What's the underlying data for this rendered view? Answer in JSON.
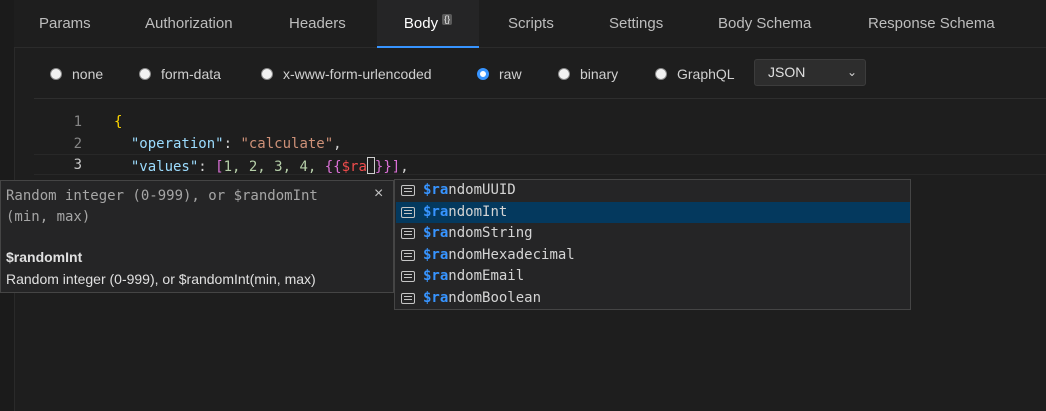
{
  "tabs": [
    {
      "label": "Params"
    },
    {
      "label": "Authorization"
    },
    {
      "label": "Headers"
    },
    {
      "label": "Body",
      "badge": "{}"
    },
    {
      "label": "Scripts"
    },
    {
      "label": "Settings"
    },
    {
      "label": "Body Schema"
    },
    {
      "label": "Response Schema"
    }
  ],
  "active_tab": "Body",
  "body_types": [
    {
      "label": "none",
      "checked": false
    },
    {
      "label": "form-data",
      "checked": false
    },
    {
      "label": "x-www-form-urlencoded",
      "checked": false
    },
    {
      "label": "raw",
      "checked": true
    },
    {
      "label": "binary",
      "checked": false
    },
    {
      "label": "GraphQL",
      "checked": false
    }
  ],
  "format_select": {
    "value": "JSON"
  },
  "editor": {
    "line_numbers": [
      "1",
      "2",
      "3"
    ],
    "line1": {
      "brace": "{"
    },
    "line2": {
      "key": "\"operation\"",
      "colon": ": ",
      "value": "\"calculate\"",
      "comma": ","
    },
    "line3": {
      "key": "\"values\"",
      "colon": ": ",
      "open_bracket": "[",
      "nums": "1, 2, 3, 4, ",
      "var_open": "{{",
      "var_typed": "$ra",
      "var_close": "}}",
      "close_bracket": "]",
      "comma": ","
    }
  },
  "suggest_detail": {
    "signature": "Random integer (0-999), or $randomInt (min, max)",
    "name": "$randomInt",
    "description": "Random integer (0-999), or $randomInt(min, max)",
    "close_glyph": "×"
  },
  "suggestions": {
    "match_prefix": "$ra",
    "items": [
      {
        "rest": "ndomUUID",
        "selected": false
      },
      {
        "rest": "ndomInt",
        "selected": true
      },
      {
        "rest": "ndomString",
        "selected": false
      },
      {
        "rest": "ndomHexadecimal",
        "selected": false
      },
      {
        "rest": "ndomEmail",
        "selected": false
      },
      {
        "rest": "ndomBoolean",
        "selected": false
      }
    ]
  },
  "colors": {
    "accent": "#3794ff",
    "selected_row": "#04395e",
    "background": "#1e1e1e"
  },
  "icons": {
    "suggestion_kind": "text-variable-icon",
    "select": "chevron-down-icon",
    "close": "close-icon"
  }
}
